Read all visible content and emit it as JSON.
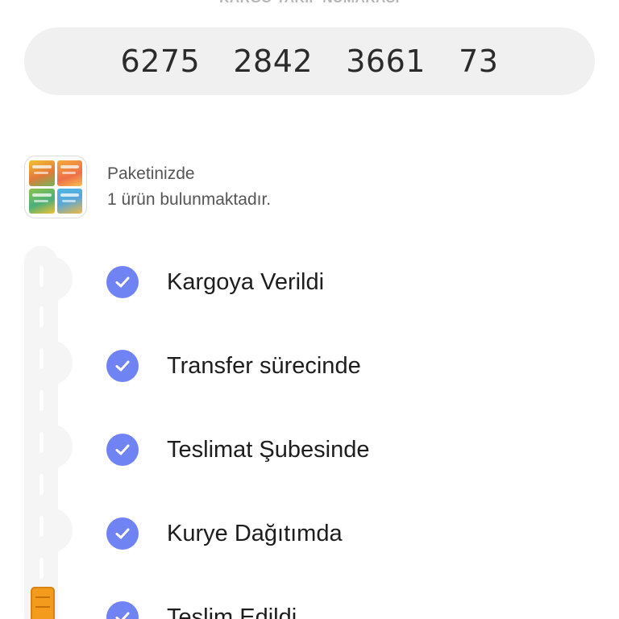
{
  "tracking": {
    "label": "KARGO TAKİP NUMARASI",
    "number": "6275  2842  3661  73"
  },
  "package": {
    "line1": "Paketinizde",
    "line2": "1 ürün bulunmaktadır.",
    "thumbnail_icon": "product-books-thumbnail"
  },
  "steps": [
    {
      "label": "Kargoya Verildi",
      "done": true
    },
    {
      "label": "Transfer sürecinde",
      "done": true
    },
    {
      "label": "Teslimat Şubesinde",
      "done": true
    },
    {
      "label": "Kurye Dağıtımda",
      "done": true
    },
    {
      "label": "Teslim Edildi",
      "done": true
    }
  ],
  "colors": {
    "check": "#6f83f2",
    "truck": "#f39b1c",
    "tracking_bg": "#f0f0f0"
  }
}
